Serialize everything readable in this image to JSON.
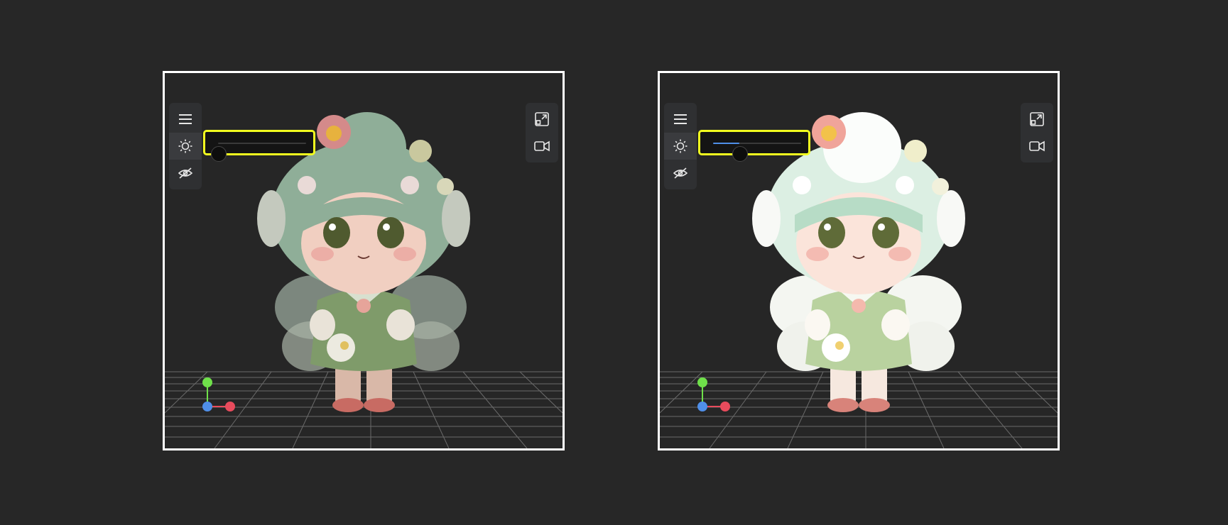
{
  "panels": [
    {
      "id": "left",
      "light_level": 0.0,
      "figure_brightness": "normal"
    },
    {
      "id": "right",
      "light_level": 0.3,
      "figure_brightness": "bright"
    }
  ],
  "toolbar_left": [
    "menu-icon",
    "sun-icon",
    "eye-off-icon"
  ],
  "toolbar_right": [
    "expand-icon",
    "video-camera-icon"
  ],
  "colors": {
    "highlight": "#f2ff1f",
    "slider_fill": "#4f8fe8",
    "axis_x": "#e84b5c",
    "axis_y": "#6fe04a",
    "axis_z": "#4f8fe8"
  }
}
